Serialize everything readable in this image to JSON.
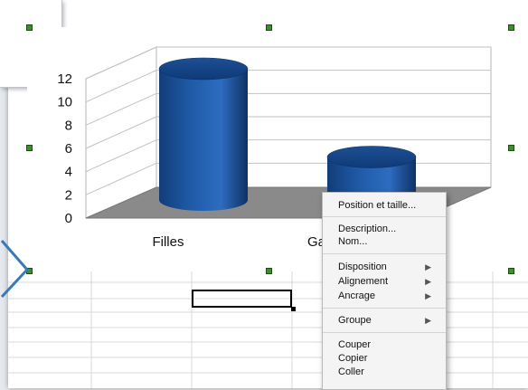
{
  "chart_data": {
    "type": "bar",
    "categories": [
      "Filles",
      "Ga"
    ],
    "values": [
      11.3,
      3.7
    ],
    "yticks": [
      "0",
      "2",
      "4",
      "6",
      "8",
      "10",
      "12"
    ],
    "ylim": [
      0,
      12
    ],
    "bar_color": "#1f5aa6",
    "grid": true,
    "style": "3d-cylinder"
  },
  "context_menu": {
    "items": [
      {
        "label": "Position et taille...",
        "submenu": false
      },
      {
        "label": "Description...",
        "submenu": false
      },
      {
        "label": "Nom...",
        "submenu": false
      },
      {
        "label": "Disposition",
        "submenu": true
      },
      {
        "label": "Alignement",
        "submenu": true
      },
      {
        "label": "Ancrage",
        "submenu": true
      },
      {
        "label": "Groupe",
        "submenu": true
      },
      {
        "label": "Couper",
        "submenu": false
      },
      {
        "label": "Copier",
        "submenu": false
      },
      {
        "label": "Coller",
        "submenu": false
      }
    ],
    "submenu_arrow": "▶"
  },
  "colors": {
    "bar": "#1f5aa6",
    "selection_handle": "#3d8f2e",
    "nav_arrow": "#3a79b8"
  }
}
